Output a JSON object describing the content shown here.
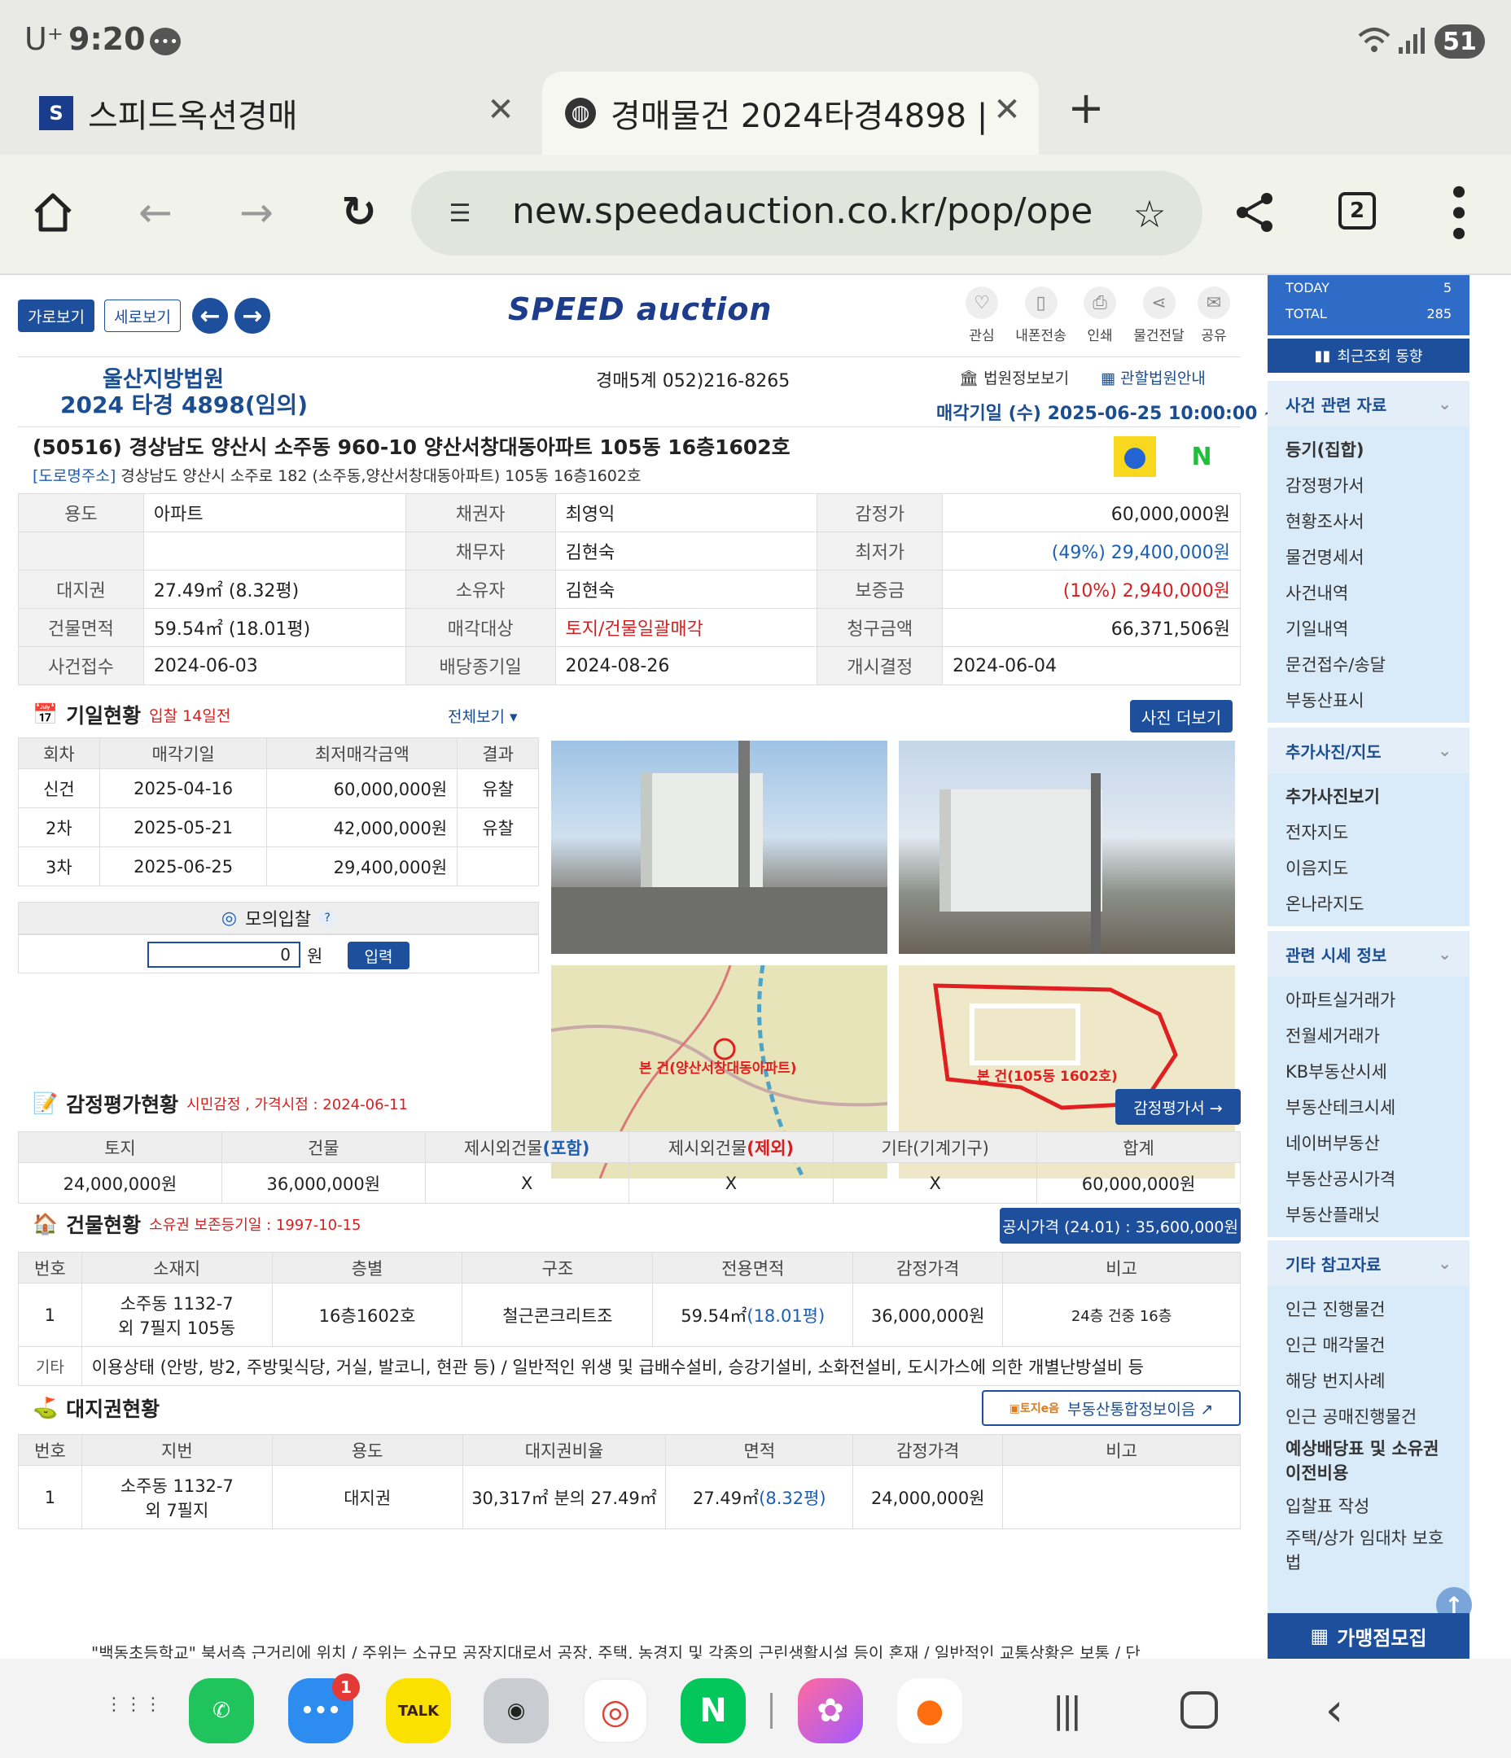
{
  "status": {
    "carrier": "U⁺",
    "time": "9:20",
    "battery": "51"
  },
  "tabs": [
    {
      "title": "스피드옥션경매"
    },
    {
      "title": "경매물건 2024타경4898 |"
    }
  ],
  "browser": {
    "url": "new.speedauction.co.kr/pop/ope",
    "tab_count": "2"
  },
  "toolbar": {
    "btn_h": "가로보기",
    "btn_v": "세로보기",
    "logo": "SPEED auction",
    "icons": [
      "관심",
      "내폰전송",
      "인쇄",
      "물건전달",
      "공유"
    ]
  },
  "case": {
    "court": "울산지방법원",
    "case_no": "2024 타경 4898(임의)",
    "dept": "경매5계 052)216-8265",
    "court_info": "법원정보보기",
    "court_guide": "관할법원안내",
    "sale_date": "매각기일 (수) 2025-06-25 10:00:00 ~",
    "address": "(50516) 경상남도 양산시 소주동 960-10 양산서창대동아파트 105동 16층1602호",
    "road_label": "[도로명주소]",
    "road_addr": "경상남도 양산시 소주로 182 (소주동,양산서창대동아파트) 105동 16층1602호"
  },
  "info": {
    "r1": [
      "용도",
      "아파트",
      "채권자",
      "최영익",
      "감정가",
      "60,000,000원"
    ],
    "r2": [
      "",
      "",
      "채무자",
      "김현숙",
      "최저가",
      "(49%) 29,400,000원"
    ],
    "r3": [
      "대지권",
      "27.49㎡ (8.32평)",
      "소유자",
      "김현숙",
      "보증금",
      "(10%) 2,940,000원"
    ],
    "r4": [
      "건물면적",
      "59.54㎡ (18.01평)",
      "매각대상",
      "토지/건물일괄매각",
      "청구금액",
      "66,371,506원"
    ],
    "r5": [
      "사건접수",
      "2024-06-03",
      "배당종기일",
      "2024-08-26",
      "개시결정",
      "2024-06-04"
    ]
  },
  "schedule": {
    "title": "기일현황",
    "badge": "입찰 14일전",
    "view_all": "전체보기 ▾",
    "photo_more": "사진 더보기",
    "headers": [
      "회차",
      "매각기일",
      "최저매각금액",
      "결과"
    ],
    "rows": [
      [
        "신건",
        "2025-04-16",
        "60,000,000원",
        "유찰"
      ],
      [
        "2차",
        "2025-05-21",
        "42,000,000원",
        "유찰"
      ],
      [
        "3차",
        "2025-06-25",
        "29,400,000원",
        ""
      ]
    ],
    "mock_title": "모의입찰",
    "mock_value": "0",
    "mock_unit": "원",
    "mock_btn": "입력"
  },
  "maps": {
    "label1": "본 건(양산서창대동아파트)",
    "label2": "본 건(105동 1602호)"
  },
  "appraisal": {
    "title": "감정평가현황",
    "sub": "시민감정 , 가격시점 : 2024-06-11",
    "btn": "감정평가서 →",
    "headers": [
      "토지",
      "건물",
      "제시외건물(포함)",
      "제시외건물(제외)",
      "기타(기계기구)",
      "합계"
    ],
    "values": [
      "24,000,000원",
      "36,000,000원",
      "X",
      "X",
      "X",
      "60,000,000원"
    ]
  },
  "building": {
    "title": "건물현황",
    "sub": "소유권 보존등기일 : 1997-10-15",
    "btn": "공시가격 (24.01) : 35,600,000원",
    "headers": [
      "번호",
      "소재지",
      "층별",
      "구조",
      "전용면적",
      "감정가격",
      "비고"
    ],
    "row": [
      "1",
      "소주동 1132-7",
      "외 7필지 105동",
      "16층1602호",
      "철근콘크리트조",
      "59.54㎡",
      "(18.01평)",
      "36,000,000원",
      "24층 건중 16층"
    ],
    "etc_label": "기타",
    "etc": "이용상태 (안방, 방2, 주방및식당, 거실, 발코니, 현관 등) / 일반적인 위생 및 급배수설비, 승강기설비, 소화전설비, 도시가스에 의한 개별난방설비 등"
  },
  "land": {
    "title": "대지권현황",
    "btn": "부동산통합정보이음 ↗",
    "headers": [
      "번호",
      "지번",
      "용도",
      "대지권비율",
      "면적",
      "감정가격",
      "비고"
    ],
    "row": [
      "1",
      "소주동 1132-7",
      "외 7필지",
      "대지권",
      "30,317㎡ 분의 27.49㎡",
      "27.49㎡",
      "(8.32평)",
      "24,000,000원"
    ],
    "cut": "\"백동초등학교\" 북서측 근거리에 위치 / 주위는 소규모 공장지대로서 공장, 주택, 농경지 및 각종의 근린생활시설 등이 혼재 / 일반적인 교통상황은 보통 / 단"
  },
  "sidebar": {
    "today_label": "TODAY",
    "today": "5",
    "total_label": "TOTAL",
    "total": "285",
    "recent": "최근조회 동향",
    "sections": [
      {
        "title": "사건 관련 자료",
        "items": [
          "등기(집합)",
          "감정평가서",
          "현황조사서",
          "물건명세서",
          "사건내역",
          "기일내역",
          "문건접수/송달",
          "부동산표시"
        ]
      },
      {
        "title": "추가사진/지도",
        "items": [
          "추가사진보기",
          "전자지도",
          "이음지도",
          "온나라지도"
        ]
      },
      {
        "title": "관련 시세 정보",
        "items": [
          "아파트실거래가",
          "전월세거래가",
          "KB부동산시세",
          "부동산테크시세",
          "네이버부동산",
          "부동산공시가격",
          "부동산플래닛"
        ]
      },
      {
        "title": "기타 참고자료",
        "items": [
          "인근 진행물건",
          "인근 매각물건",
          "해당 번지사례",
          "인근 공매진행물건",
          "예상배당표 및 소유권 이전비용",
          "입찰표 작성",
          "주택/상가 임대차 보호법"
        ]
      }
    ],
    "banner": "가맹점모집"
  },
  "dock": {
    "badge": "1"
  }
}
